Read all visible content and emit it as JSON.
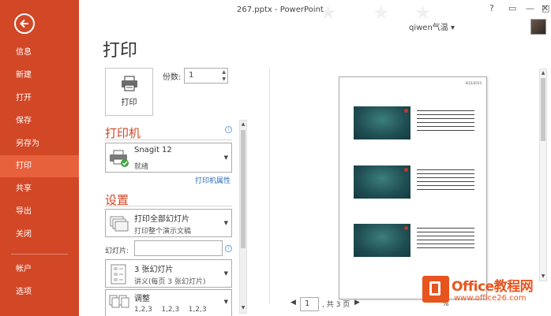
{
  "window": {
    "title": "267.pptx - PowerPoint",
    "help": "?",
    "minimize": "—",
    "maximize": "□",
    "close": "✕",
    "user": "qiwen气温 ▾"
  },
  "nav": {
    "items": [
      "信息",
      "新建",
      "打开",
      "保存",
      "另存为",
      "打印",
      "共享",
      "导出",
      "关闭",
      "帐户",
      "选项"
    ],
    "active": "打印"
  },
  "print": {
    "page_title": "打印",
    "print_button": "打印",
    "copies_label": "份数:",
    "copies_value": "1"
  },
  "printer": {
    "header": "打印机",
    "name": "Snagit 12",
    "status": "就绪",
    "properties_link": "打印机属性"
  },
  "settings": {
    "header": "设置",
    "range_main": "打印全部幻灯片",
    "range_sub": "打印整个演示文稿",
    "slides_label": "幻灯片:",
    "slides_value": "",
    "layout_main": "3 张幻灯片",
    "layout_sub": "讲义(每页 3 张幻灯片)",
    "collate_main": "调整",
    "collate_sub": "1,2,3    1,2,3    1,2,3"
  },
  "preview": {
    "date": "9/23/2015",
    "page_value": "1",
    "page_total": ", 共 3 页",
    "zoom": "%"
  },
  "watermark": {
    "title": "Office教程网",
    "url": "www.office26.com"
  },
  "colors": {
    "accent": "#d24726",
    "link": "#2a6ebb"
  }
}
